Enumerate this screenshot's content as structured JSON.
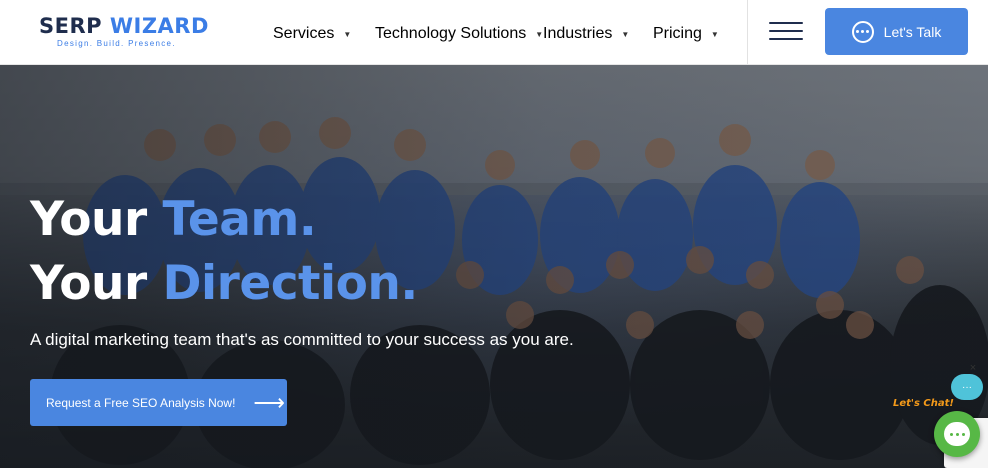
{
  "header": {
    "logo": {
      "title_a": "SERP ",
      "title_b": "WIZARD",
      "tagline": "Design. Build. Presence."
    },
    "nav": [
      {
        "label": "Services"
      },
      {
        "label": "Technology Solutions"
      },
      {
        "label": "Industries"
      },
      {
        "label": "Pricing"
      }
    ],
    "cta_label": "Let's Talk"
  },
  "hero": {
    "line1_white": "Your ",
    "line1_accent": "Team.",
    "line2_white": "Your ",
    "line2_accent": "Direction.",
    "subtitle": "A digital marketing team that's as committed to your success as you are.",
    "cta_label": "Request a Free SEO Analysis Now!",
    "cta_icon": "arrow-right-icon"
  },
  "chat": {
    "close": "×",
    "bubble": "···",
    "label": "Let's Chat!"
  },
  "colors": {
    "brand_blue": "#4a86e0",
    "accent_text": "#5a93ea",
    "navy": "#1f2d4d",
    "chat_green": "#57b846",
    "chat_orange": "#f39a1a"
  }
}
